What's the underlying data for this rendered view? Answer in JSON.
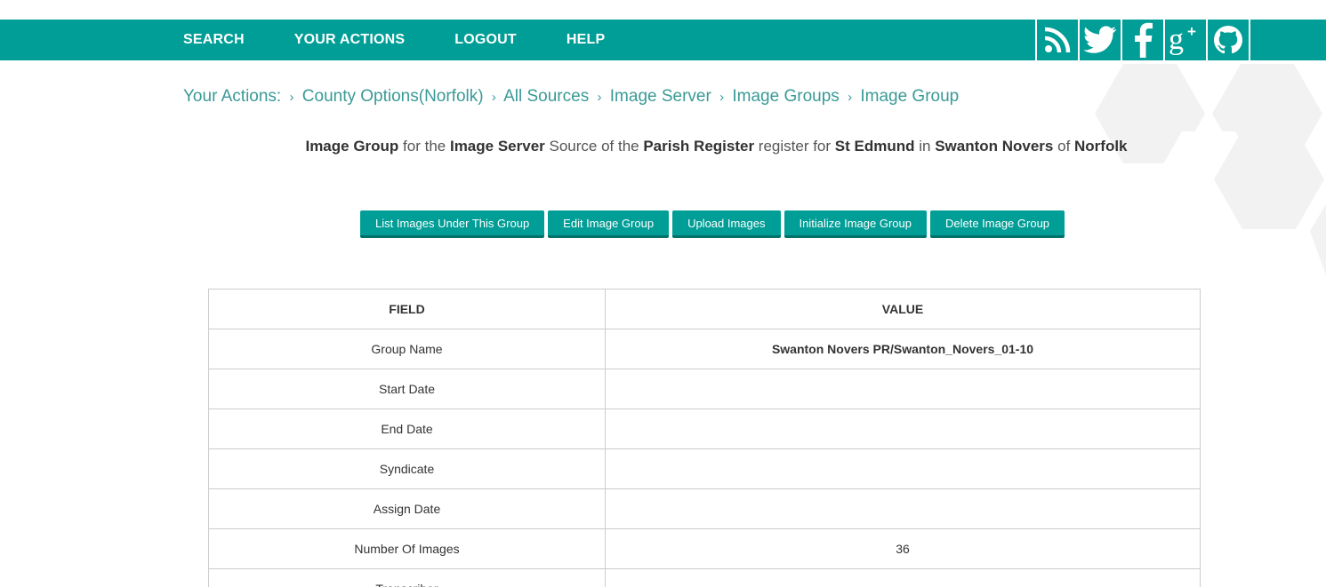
{
  "nav": {
    "items": [
      "SEARCH",
      "YOUR ACTIONS",
      "LOGOUT",
      "HELP"
    ],
    "social": [
      "rss-icon",
      "twitter-icon",
      "facebook-icon",
      "google-plus-icon",
      "github-icon"
    ],
    "color": "#009e96"
  },
  "breadcrumb": {
    "root": "Your Actions:",
    "items": [
      "County Options(Norfolk)",
      "All Sources",
      "Image Server",
      "Image Groups",
      "Image Group"
    ]
  },
  "heading": {
    "t1": "Image Group",
    "t2": " for the ",
    "t3": "Image Server",
    "t4": " Source of the ",
    "t5": "Parish Register",
    "t6": " register for ",
    "t7": "St Edmund",
    "t8": " in ",
    "t9": "Swanton Novers",
    "t10": " of ",
    "t11": "Norfolk"
  },
  "buttons": [
    "List Images Under This Group",
    "Edit Image Group",
    "Upload Images",
    "Initialize Image Group",
    "Delete Image Group"
  ],
  "table": {
    "headers": [
      "FIELD",
      "VALUE"
    ],
    "rows": [
      {
        "field": "Group Name",
        "value": "Swanton Novers PR/Swanton_Novers_01-10"
      },
      {
        "field": "Start Date",
        "value": ""
      },
      {
        "field": "End Date",
        "value": ""
      },
      {
        "field": "Syndicate",
        "value": ""
      },
      {
        "field": "Assign Date",
        "value": ""
      },
      {
        "field": "Number Of Images",
        "value": "36"
      },
      {
        "field": "Transcriber",
        "value": ""
      }
    ]
  }
}
